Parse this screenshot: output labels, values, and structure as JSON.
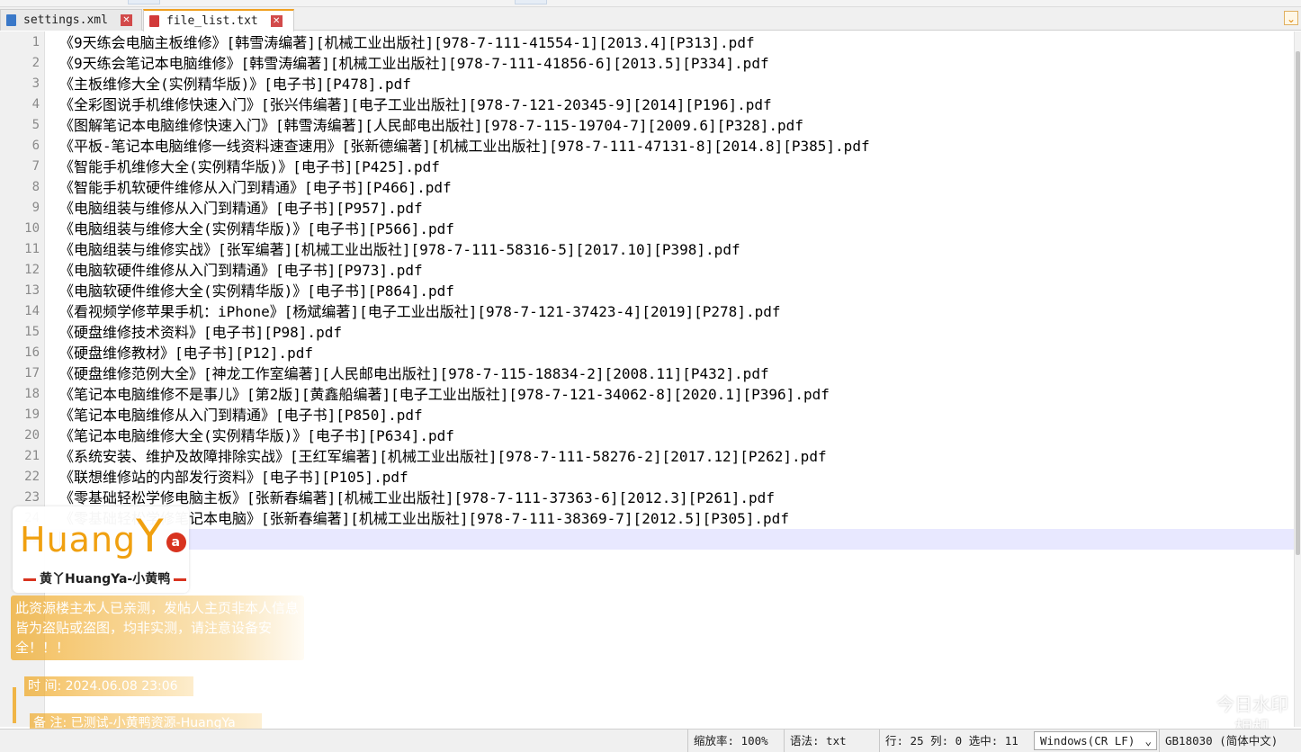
{
  "tabs": [
    {
      "name": "settings.xml",
      "active": false,
      "close": "✕"
    },
    {
      "name": "file_list.txt",
      "active": true,
      "close": "✕"
    }
  ],
  "tab_list_button": "⌄",
  "lines": [
    {
      "n": "1",
      "text": "《9天练会电脑主板维修》[韩雪涛编著][机械工业出版社][978-7-111-41554-1][2013.4][P313].pdf"
    },
    {
      "n": "2",
      "text": "《9天练会笔记本电脑维修》[韩雪涛编著][机械工业出版社][978-7-111-41856-6][2013.5][P334].pdf"
    },
    {
      "n": "3",
      "text": "《主板维修大全(实例精华版)》[电子书][P478].pdf"
    },
    {
      "n": "4",
      "text": "《全彩图说手机维修快速入门》[张兴伟编著][电子工业出版社][978-7-121-20345-9][2014][P196].pdf"
    },
    {
      "n": "5",
      "text": "《图解笔记本电脑维修快速入门》[韩雪涛编著][人民邮电出版社][978-7-115-19704-7][2009.6][P328].pdf"
    },
    {
      "n": "6",
      "text": "《平板-笔记本电脑维修一线资料速查速用》[张新德编著][机械工业出版社][978-7-111-47131-8][2014.8][P385].pdf"
    },
    {
      "n": "7",
      "text": "《智能手机维修大全(实例精华版)》[电子书][P425].pdf"
    },
    {
      "n": "8",
      "text": "《智能手机软硬件维修从入门到精通》[电子书][P466].pdf"
    },
    {
      "n": "9",
      "text": "《电脑组装与维修从入门到精通》[电子书][P957].pdf"
    },
    {
      "n": "10",
      "text": "《电脑组装与维修大全(实例精华版)》[电子书][P566].pdf"
    },
    {
      "n": "11",
      "text": "《电脑组装与维修实战》[张军编著][机械工业出版社][978-7-111-58316-5][2017.10][P398].pdf"
    },
    {
      "n": "12",
      "text": "《电脑软硬件维修从入门到精通》[电子书][P973].pdf"
    },
    {
      "n": "13",
      "text": "《电脑软硬件维修大全(实例精华版)》[电子书][P864].pdf"
    },
    {
      "n": "14",
      "text": "《看视频学修苹果手机：iPhone》[杨斌编著][电子工业出版社][978-7-121-37423-4][2019][P278].pdf"
    },
    {
      "n": "15",
      "text": "《硬盘维修技术资料》[电子书][P98].pdf"
    },
    {
      "n": "16",
      "text": "《硬盘维修教材》[电子书][P12].pdf"
    },
    {
      "n": "17",
      "text": "《硬盘维修范例大全》[神龙工作室编著][人民邮电出版社][978-7-115-18834-2][2008.11][P432].pdf"
    },
    {
      "n": "18",
      "text": "《笔记本电脑维修不是事儿》[第2版][黄鑫船编著][电子工业出版社][978-7-121-34062-8][2020.1][P396].pdf"
    },
    {
      "n": "19",
      "text": "《笔记本电脑维修从入门到精通》[电子书][P850].pdf"
    },
    {
      "n": "20",
      "text": "《笔记本电脑维修大全(实例精华版)》[电子书][P634].pdf"
    },
    {
      "n": "21",
      "text": "《系统安装、维护及故障排除实战》[王红军编著][机械工业出版社][978-7-111-58276-2][2017.12][P262].pdf"
    },
    {
      "n": "22",
      "text": "《联想维修站的内部发行资料》[电子书][P105].pdf"
    },
    {
      "n": "23",
      "text": "《零基础轻松学修电脑主板》[张新春编著][机械工业出版社][978-7-111-37363-6][2012.3][P261].pdf"
    },
    {
      "n": "24",
      "text": "《零基础轻松学修笔记本电脑》[张新春编著][机械工业出版社][978-7-111-38369-7][2012.5][P305].pdf"
    },
    {
      "n": "25",
      "text": ""
    }
  ],
  "status": {
    "zoom": "缩放率: 100%",
    "syntax": "语法: txt",
    "position": "行: 25  列: 0  选中: 11",
    "eol": "Windows(CR LF)",
    "eol_arrow": "⌄",
    "encoding": "GB18030 (简体中文)"
  },
  "watermark": {
    "logo_text": "Huang",
    "logo_y": "Y",
    "logo_a": "a",
    "caption": "黄丫HuangYa-小黄鸭",
    "notice": "此资源楼主本人已亲测，发帖人主页非本人信息皆为盗贴或盗图，均非实测，请注意设备安全！！！",
    "time": "时  间: 2024.06.08 23:06",
    "note": "备  注: 已测试-小黄鸭资源-HuangYa",
    "corner_line1": "今日水印",
    "corner_line2": "相机"
  }
}
